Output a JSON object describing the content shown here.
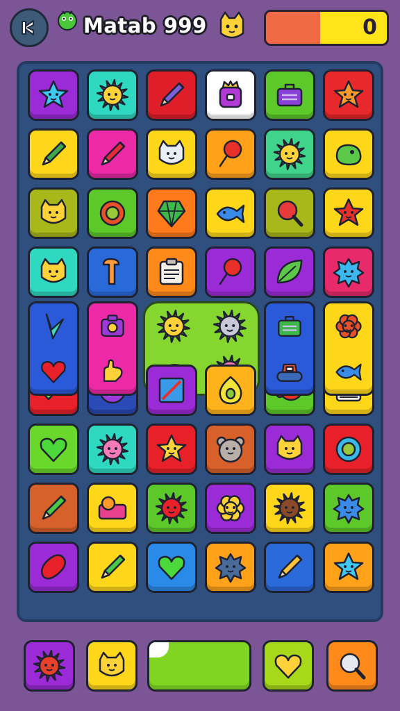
{
  "header": {
    "title": "Matab 999",
    "score": "0",
    "back_icon": "back-arrow-icon",
    "mascot_icon": "green-creature-icon",
    "badge_icon": "yellow-cat-icon",
    "meter_colors": [
      "#f06a43",
      "#ffe41a"
    ],
    "meter_level": 0.45
  },
  "board": {
    "tiles": [
      {
        "row": 0,
        "col": 0,
        "bg": "#9b2bd6",
        "icon": "star-icon",
        "fg": "#3ec7f0"
      },
      {
        "row": 0,
        "col": 1,
        "bg": "#2fd8c0",
        "icon": "sun-icon",
        "fg": "#ffd23a"
      },
      {
        "row": 0,
        "col": 2,
        "bg": "#e01e2a",
        "icon": "pencil-icon",
        "fg": "#7a5fd8"
      },
      {
        "row": 0,
        "col": 3,
        "bg": "#ffffff",
        "icon": "crown-box-icon",
        "fg": "#b43ad6"
      },
      {
        "row": 0,
        "col": 4,
        "bg": "#5cc82a",
        "icon": "briefcase-icon",
        "fg": "#8a3fd8"
      },
      {
        "row": 0,
        "col": 5,
        "bg": "#e8282a",
        "icon": "star-icon",
        "fg": "#ff9a2a"
      },
      {
        "row": 1,
        "col": 0,
        "bg": "#ffd71a",
        "icon": "pencil-icon",
        "fg": "#3fa84a"
      },
      {
        "row": 1,
        "col": 1,
        "bg": "#ec2aa8",
        "icon": "pencil-icon",
        "fg": "#e82a3a"
      },
      {
        "row": 1,
        "col": 2,
        "bg": "#ffd71a",
        "icon": "cat-icon",
        "fg": "#e8eef6"
      },
      {
        "row": 1,
        "col": 3,
        "bg": "#ffa21a",
        "icon": "lollipop-icon",
        "fg": "#e8302a"
      },
      {
        "row": 1,
        "col": 4,
        "bg": "#3fd48a",
        "icon": "sun-icon",
        "fg": "#ffd23a"
      },
      {
        "row": 1,
        "col": 5,
        "bg": "#ffd71a",
        "icon": "blob-icon",
        "fg": "#5cc84a"
      },
      {
        "row": 2,
        "col": 0,
        "bg": "#a8b81a",
        "icon": "cat-icon",
        "fg": "#ffd23a"
      },
      {
        "row": 2,
        "col": 1,
        "bg": "#5cc82a",
        "icon": "ring-icon",
        "fg": "#e8502a"
      },
      {
        "row": 2,
        "col": 2,
        "bg": "#ff7a1a",
        "icon": "gem-icon",
        "fg": "#3fb84a"
      },
      {
        "row": 2,
        "col": 3,
        "bg": "#ffd71a",
        "icon": "fish-icon",
        "fg": "#3a8ae8"
      },
      {
        "row": 2,
        "col": 4,
        "bg": "#a8b81a",
        "icon": "magnifier-icon",
        "fg": "#e83a3a"
      },
      {
        "row": 2,
        "col": 5,
        "bg": "#ffd71a",
        "icon": "star-icon",
        "fg": "#e8302a"
      },
      {
        "row": 3,
        "col": 0,
        "bg": "#2fd8c0",
        "icon": "cat-icon",
        "fg": "#ffd23a"
      },
      {
        "row": 3,
        "col": 1,
        "bg": "#2a6ad8",
        "icon": "hook-icon",
        "fg": "#ff9a3a"
      },
      {
        "row": 3,
        "col": 2,
        "bg": "#ff8a1a",
        "icon": "clipboard-icon",
        "fg": "#f4f0e8"
      },
      {
        "row": 3,
        "col": 3,
        "bg": "#9b2bd6",
        "icon": "lollipop-icon",
        "fg": "#e8302a"
      },
      {
        "row": 3,
        "col": 4,
        "bg": "#9b2bd6",
        "icon": "leaf-icon",
        "fg": "#5cc84a"
      },
      {
        "row": 3,
        "col": 5,
        "bg": "#e82a6a",
        "icon": "splat-icon",
        "fg": "#3ab8f0"
      },
      {
        "row": 5,
        "col": 0,
        "bg": "#e8202a",
        "icon": "check-icon",
        "fg": "#6ad83a"
      },
      {
        "row": 5,
        "col": 1,
        "bg": "#2a4ab8",
        "icon": "spiral-icon",
        "fg": "#9b3ad8"
      },
      {
        "row": 5,
        "col": 2,
        "bg": "#9b2bd6",
        "icon": "picture-icon",
        "fg": "#3a9ae8"
      },
      {
        "row": 5,
        "col": 3,
        "bg": "#ffb21a",
        "icon": "egg-icon",
        "fg": "#f4e43a"
      },
      {
        "row": 5,
        "col": 4,
        "bg": "#5cc82a",
        "icon": "beetle-icon",
        "fg": "#e8302a"
      },
      {
        "row": 5,
        "col": 5,
        "bg": "#ffd71a",
        "icon": "radio-icon",
        "fg": "#e8302a"
      },
      {
        "row": 6,
        "col": 0,
        "bg": "#6ad82a",
        "icon": "heart-icon",
        "fg": "#4ad83a"
      },
      {
        "row": 6,
        "col": 1,
        "bg": "#2fd8c0",
        "icon": "sun-icon",
        "fg": "#f47ab8"
      },
      {
        "row": 6,
        "col": 2,
        "bg": "#e8202a",
        "icon": "star-icon",
        "fg": "#ffd23a"
      },
      {
        "row": 6,
        "col": 3,
        "bg": "#d8602a",
        "icon": "bear-icon",
        "fg": "#b8b0a8"
      },
      {
        "row": 6,
        "col": 4,
        "bg": "#9b2bd6",
        "icon": "cat-icon",
        "fg": "#ffd23a"
      },
      {
        "row": 6,
        "col": 5,
        "bg": "#e8202a",
        "icon": "ring-icon",
        "fg": "#3ab8e8"
      },
      {
        "row": 7,
        "col": 0,
        "bg": "#d8602a",
        "icon": "pencil-icon",
        "fg": "#4ac84a"
      },
      {
        "row": 7,
        "col": 1,
        "bg": "#ffd71a",
        "icon": "box-icon",
        "fg": "#e8408a"
      },
      {
        "row": 7,
        "col": 2,
        "bg": "#5cc82a",
        "icon": "sun-icon",
        "fg": "#e8202a"
      },
      {
        "row": 7,
        "col": 3,
        "bg": "#9b2bd6",
        "icon": "flower-icon",
        "fg": "#ffd23a"
      },
      {
        "row": 7,
        "col": 4,
        "bg": "#ffd71a",
        "icon": "sun-icon",
        "fg": "#8a4a2a"
      },
      {
        "row": 7,
        "col": 5,
        "bg": "#5cc82a",
        "icon": "splat-icon",
        "fg": "#3a8ae8"
      },
      {
        "row": 8,
        "col": 0,
        "bg": "#9b2bd6",
        "icon": "bean-icon",
        "fg": "#e8202a"
      },
      {
        "row": 8,
        "col": 1,
        "bg": "#ffd71a",
        "icon": "pencil-icon",
        "fg": "#4ac84a"
      },
      {
        "row": 8,
        "col": 2,
        "bg": "#2a8ae8",
        "icon": "heart-icon",
        "fg": "#4ad83a"
      },
      {
        "row": 8,
        "col": 3,
        "bg": "#ffa21a",
        "icon": "splat-icon",
        "fg": "#4a6a9a"
      },
      {
        "row": 8,
        "col": 4,
        "bg": "#2a6ad8",
        "icon": "pencil-icon",
        "fg": "#ffc23a"
      },
      {
        "row": 8,
        "col": 5,
        "bg": "#ffa21a",
        "icon": "star-icon",
        "fg": "#3ec7f0"
      }
    ],
    "tall_tiles": [
      {
        "col": 0,
        "bg": "#2a5ad8",
        "icons": [
          {
            "icon": "arrow-icon",
            "fg": "#3fd8b8"
          },
          {
            "icon": "heart-icon",
            "fg": "#e8202a"
          }
        ]
      },
      {
        "col": 1,
        "bg": "#ec2aa8",
        "icons": [
          {
            "icon": "camera-icon",
            "fg": "#9b3ad8"
          },
          {
            "icon": "hand-icon",
            "fg": "#ffd23a"
          }
        ]
      },
      {
        "col": 4,
        "bg": "#2a5ad8",
        "icons": [
          {
            "icon": "briefcase-icon",
            "fg": "#3fb84a"
          },
          {
            "icon": "tank-icon",
            "fg": "#e8502a"
          }
        ]
      },
      {
        "col": 5,
        "bg": "#ffd71a",
        "icons": [
          {
            "icon": "flower-icon",
            "fg": "#e8502a"
          },
          {
            "icon": "fish-icon",
            "fg": "#3a8ae8"
          }
        ]
      }
    ],
    "combo_icons": [
      {
        "icon": "sun-icon",
        "fg": "#ffd23a"
      },
      {
        "icon": "sun-icon",
        "fg": "#c8c8d8"
      },
      {
        "icon": "eye-icon",
        "fg": "#e8302a"
      },
      {
        "icon": "sun-icon",
        "fg": "#f47ab8"
      }
    ]
  },
  "bottom_bar": {
    "buttons": [
      {
        "name": "sun-booster",
        "bg": "#9b2bd6",
        "icon": "sun-icon",
        "fg": "#e8402a"
      },
      {
        "name": "cat-booster",
        "bg": "#ffd71a",
        "icon": "cat-icon",
        "fg": "#ffd23a"
      },
      {
        "name": "heart-booster",
        "bg": "#a8d81a",
        "icon": "heart-icon",
        "fg": "#ffd23a"
      },
      {
        "name": "search-booster",
        "bg": "#ff8a1a",
        "icon": "magnifier-icon",
        "fg": "#e8e8f0"
      }
    ],
    "power_color": "#7fd522"
  }
}
